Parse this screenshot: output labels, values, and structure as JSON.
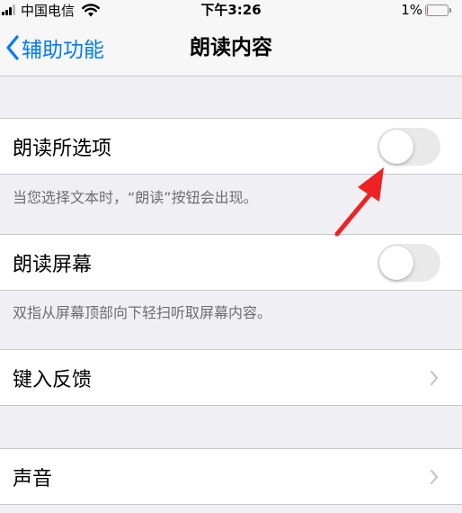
{
  "status_bar": {
    "carrier": "中国电信",
    "time": "下午3:26",
    "battery_percent": "1%",
    "battery_level": 0.05,
    "battery_color": "#ff3b30"
  },
  "nav": {
    "back_label": "辅助功能",
    "back_icon": "chevron-left-icon",
    "title": "朗读内容",
    "accent_color": "#007aff"
  },
  "speak_selection": {
    "label": "朗读所选项",
    "toggle_on": false,
    "footer": "当您选择文本时，“朗读”按钮会出现。"
  },
  "speak_screen": {
    "label": "朗读屏幕",
    "toggle_on": false,
    "footer": "双指从屏幕顶部向下轻扫听取屏幕内容。"
  },
  "typing_feedback": {
    "label": "键入反馈",
    "icon": "chevron-right-icon"
  },
  "voices": {
    "label": "声音",
    "icon": "chevron-right-icon"
  },
  "annotation": {
    "icon": "red-arrow-icon",
    "color": "#ee2222"
  }
}
